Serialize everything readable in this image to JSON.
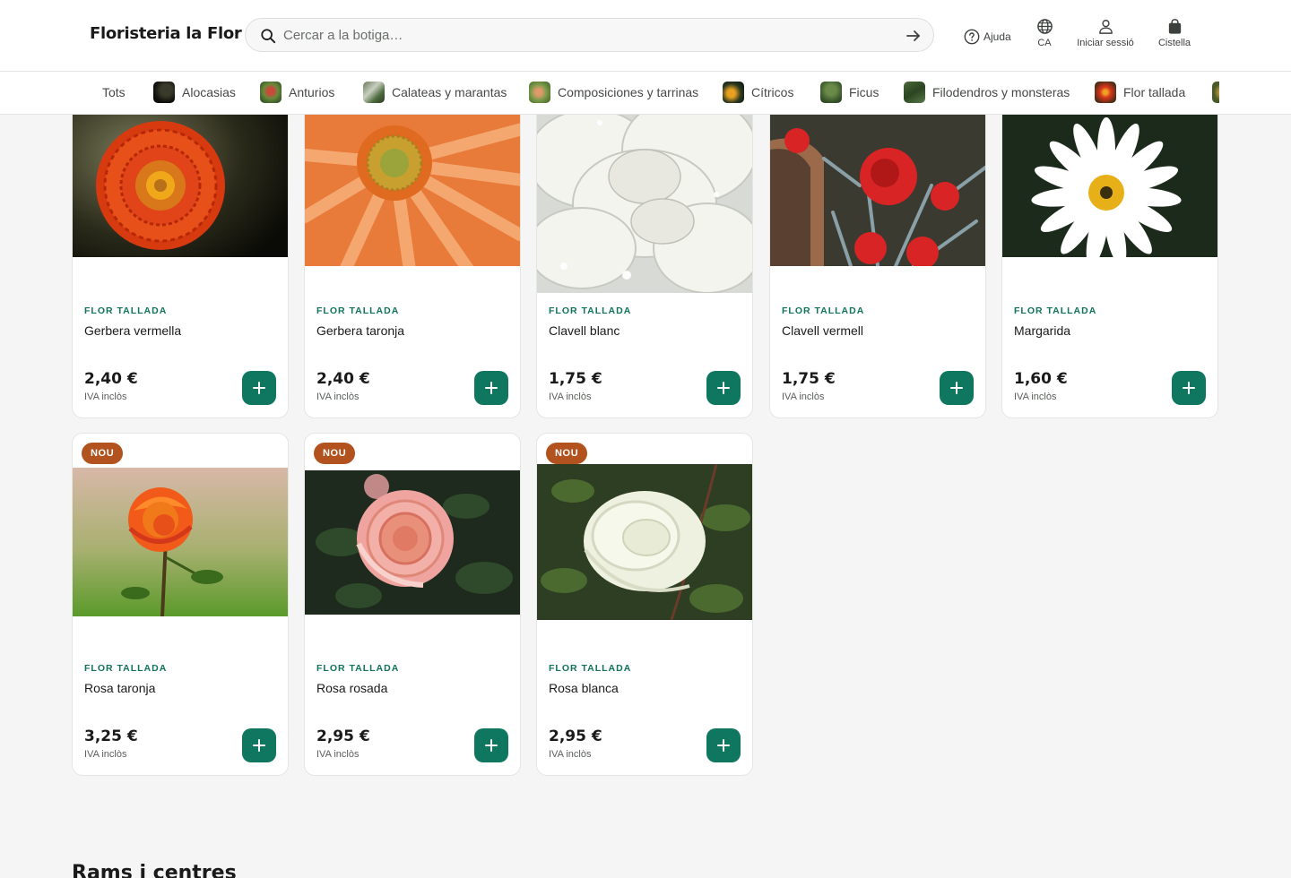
{
  "header": {
    "logo": "Floristeria la Flor",
    "search_placeholder": "Cercar a la botiga…",
    "help": "Ajuda",
    "language": "CA",
    "login": "Iniciar sessió",
    "cart": "Cistella"
  },
  "categories": [
    {
      "label": "Tots",
      "icon": "none"
    },
    {
      "label": "Alocasias",
      "icon": "alocasia-thumb"
    },
    {
      "label": "Anturios",
      "icon": "anturio-thumb"
    },
    {
      "label": "Calateas y marantas",
      "icon": "calatea-thumb"
    },
    {
      "label": "Composiciones y tarrinas",
      "icon": "composition-thumb"
    },
    {
      "label": "Cítricos",
      "icon": "citrus-thumb"
    },
    {
      "label": "Ficus",
      "icon": "ficus-thumb"
    },
    {
      "label": "Filodendros y monsteras",
      "icon": "philodendron-thumb"
    },
    {
      "label": "Flor tallada",
      "icon": "cut-flower-thumb"
    }
  ],
  "products": [
    {
      "category": "FLOR TALLADA",
      "name": "Gerbera vermella",
      "price": "2,40 €",
      "vat": "IVA inclòs",
      "badge": "",
      "image": "red-gerbera"
    },
    {
      "category": "FLOR TALLADA",
      "name": "Gerbera taronja",
      "price": "2,40 €",
      "vat": "IVA inclòs",
      "badge": "",
      "image": "orange-gerbera"
    },
    {
      "category": "FLOR TALLADA",
      "name": "Clavell blanc",
      "price": "1,75 €",
      "vat": "IVA inclòs",
      "badge": "",
      "image": "white-carnation"
    },
    {
      "category": "FLOR TALLADA",
      "name": "Clavell vermell",
      "price": "1,75 €",
      "vat": "IVA inclòs",
      "badge": "",
      "image": "red-carnation"
    },
    {
      "category": "FLOR TALLADA",
      "name": "Margarida",
      "price": "1,60 €",
      "vat": "IVA inclòs",
      "badge": "",
      "image": "daisy"
    },
    {
      "category": "FLOR TALLADA",
      "name": "Rosa taronja",
      "price": "3,25 €",
      "vat": "IVA inclòs",
      "badge": "NOU",
      "image": "orange-rose"
    },
    {
      "category": "FLOR TALLADA",
      "name": "Rosa rosada",
      "price": "2,95 €",
      "vat": "IVA inclòs",
      "badge": "NOU",
      "image": "pink-rose"
    },
    {
      "category": "FLOR TALLADA",
      "name": "Rosa blanca",
      "price": "2,95 €",
      "vat": "IVA inclòs",
      "badge": "NOU",
      "image": "white-rose"
    }
  ],
  "next_section": {
    "title": "Rams i centres"
  },
  "colors": {
    "accent": "#0f7660",
    "badge": "#b2531f",
    "background": "#f4f5f4"
  }
}
